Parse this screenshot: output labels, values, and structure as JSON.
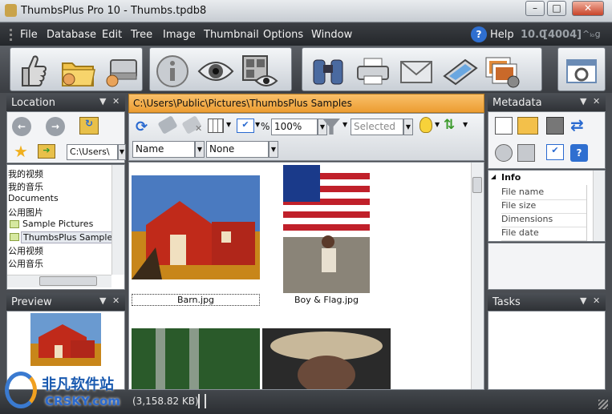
{
  "window": {
    "title": "ThumbsPlus Pro 10 - Thumbs.tpdb8",
    "minimize": "–",
    "maximize": "□",
    "close": "✕"
  },
  "menu": {
    "items": [
      "File",
      "Database",
      "Edit",
      "Tree",
      "Image",
      "Thumbnail",
      "Options",
      "Window"
    ],
    "help": "Help",
    "version": "10.0",
    "build": "[4004]"
  },
  "location_panel": {
    "title": "Location",
    "pin": "▼",
    "close": "✕",
    "path_combo": "C:\\Users\\",
    "tree": [
      "我的视频",
      "我的音乐",
      "Documents",
      "公用图片",
      "Sample Pictures",
      "ThumbsPlus Samples",
      "公用视频",
      "公用音乐"
    ]
  },
  "preview_panel": {
    "title": "Preview",
    "pin": "▼",
    "close": "✕"
  },
  "browser": {
    "path": "C:\\Users\\Public\\Pictures\\ThumbsPlus Samples",
    "zoom": "100%",
    "zoom_symbol": "%",
    "filter_value": "Selected",
    "sort_primary": "Name",
    "sort_secondary": "None",
    "thumbnails": [
      {
        "caption": "Barn.jpg"
      },
      {
        "caption": "Boy & Flag.jpg"
      }
    ]
  },
  "metadata_panel": {
    "title": "Metadata",
    "pin": "▼",
    "close": "✕",
    "section": "Info",
    "fields": [
      "File name",
      "File size",
      "Dimensions",
      "File date"
    ]
  },
  "tasks_panel": {
    "title": "Tasks",
    "pin": "▼",
    "close": "✕"
  },
  "status": {
    "text": "(3,158.82 KB)"
  },
  "watermark": {
    "line1": "非凡软件站",
    "line2": "CRSKY.com"
  }
}
